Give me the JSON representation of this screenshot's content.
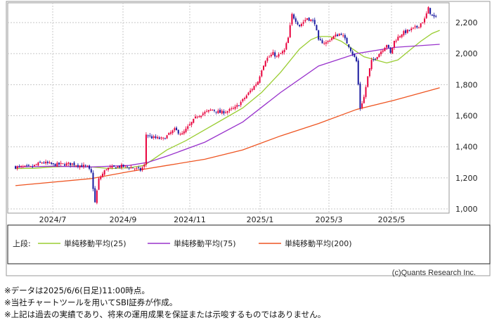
{
  "chart_data": {
    "type": "candlestick",
    "x_tick_labels": [
      "2024/7",
      "2024/9",
      "2024/11",
      "2025/1",
      "2025/3",
      "2025/5"
    ],
    "y_ticks": [
      1000,
      1200,
      1400,
      1600,
      1800,
      2000,
      2200
    ],
    "y_tick_labels": [
      "1,000",
      "1,200",
      "1,400",
      "1,600",
      "1,800",
      "2,000",
      "2,200"
    ],
    "ylim": [
      1000,
      2300
    ],
    "grid": true,
    "y_axis_side": "right",
    "up_color": "#e8003c",
    "down_color": "#1a1aa0",
    "price_path": [
      [
        0,
        1270
      ],
      [
        8,
        1268
      ],
      [
        14,
        1300
      ],
      [
        20,
        1285
      ],
      [
        30,
        1290
      ],
      [
        38,
        1270
      ],
      [
        40,
        1230
      ],
      [
        42,
        1040
      ],
      [
        44,
        1190
      ],
      [
        48,
        1260
      ],
      [
        56,
        1275
      ],
      [
        62,
        1265
      ],
      [
        66,
        1250
      ],
      [
        68,
        1280
      ],
      [
        69,
        1480
      ],
      [
        72,
        1460
      ],
      [
        78,
        1450
      ],
      [
        84,
        1510
      ],
      [
        88,
        1480
      ],
      [
        92,
        1540
      ],
      [
        96,
        1600
      ],
      [
        100,
        1620
      ],
      [
        104,
        1640
      ],
      [
        108,
        1620
      ],
      [
        112,
        1630
      ],
      [
        116,
        1650
      ],
      [
        120,
        1700
      ],
      [
        124,
        1760
      ],
      [
        128,
        1820
      ],
      [
        130,
        1900
      ],
      [
        132,
        1960
      ],
      [
        136,
        2000
      ],
      [
        138,
        1980
      ],
      [
        142,
        2020
      ],
      [
        144,
        2100
      ],
      [
        146,
        2250
      ],
      [
        150,
        2180
      ],
      [
        154,
        2230
      ],
      [
        158,
        2200
      ],
      [
        160,
        2080
      ],
      [
        164,
        2070
      ],
      [
        168,
        2110
      ],
      [
        172,
        2130
      ],
      [
        176,
        2050
      ],
      [
        180,
        1950
      ],
      [
        182,
        1650
      ],
      [
        184,
        1720
      ],
      [
        186,
        1850
      ],
      [
        188,
        1950
      ],
      [
        192,
        2000
      ],
      [
        196,
        2060
      ],
      [
        198,
        2000
      ],
      [
        200,
        2080
      ],
      [
        204,
        2130
      ],
      [
        208,
        2150
      ],
      [
        212,
        2170
      ],
      [
        216,
        2220
      ],
      [
        218,
        2290
      ],
      [
        220,
        2240
      ],
      [
        222,
        2230
      ]
    ],
    "series": [
      {
        "name": "単純移動平均(25)",
        "color": "#9acd32",
        "x": [
          0,
          10,
          20,
          30,
          40,
          50,
          60,
          68,
          80,
          90,
          100,
          110,
          120,
          130,
          140,
          150,
          156,
          160,
          166,
          172,
          178,
          184,
          190,
          196,
          202,
          208,
          214,
          220,
          224
        ],
        "values": [
          1260,
          1262,
          1270,
          1275,
          1270,
          1260,
          1265,
          1280,
          1380,
          1440,
          1510,
          1580,
          1650,
          1750,
          1880,
          2030,
          2090,
          2110,
          2110,
          2080,
          2030,
          1980,
          1960,
          1940,
          1960,
          2020,
          2080,
          2130,
          2150
        ]
      },
      {
        "name": "単純移動平均(75)",
        "color": "#9933cc",
        "x": [
          0,
          20,
          40,
          60,
          70,
          80,
          100,
          120,
          140,
          160,
          180,
          200,
          224
        ],
        "values": [
          1270,
          1275,
          1270,
          1280,
          1300,
          1340,
          1430,
          1560,
          1750,
          1920,
          2000,
          2040,
          2060
        ]
      },
      {
        "name": "単純移動平均(200)",
        "color": "#ee5522",
        "x": [
          0,
          40,
          60,
          80,
          100,
          120,
          140,
          160,
          180,
          200,
          224
        ],
        "values": [
          1150,
          1195,
          1240,
          1280,
          1320,
          1380,
          1470,
          1550,
          1640,
          1700,
          1780
        ]
      }
    ]
  },
  "legend": {
    "prefix": "上段:",
    "items": [
      "単純移動平均(25)",
      "単純移動平均(75)",
      "単純移動平均(200)"
    ]
  },
  "copyright": "(c)Quants Research Inc.",
  "notes": [
    "※データは2025/6/6(日足)11:00時点。",
    "※当社チャートツールを用いてSBI証券が作成。",
    "※上記は過去の実績であり、将来の運用成果を保証または示唆するものではありません。"
  ]
}
